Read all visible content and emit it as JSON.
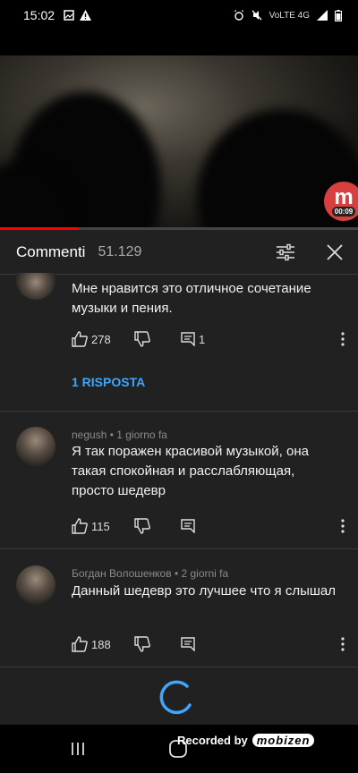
{
  "status_bar": {
    "time": "15:02",
    "icons": [
      "image-icon",
      "warning-icon"
    ],
    "right_icons": [
      "alarm-icon",
      "mute-icon",
      "4g-icon",
      "signal-icon",
      "battery-icon"
    ],
    "right_text": "VoLTE 4G"
  },
  "video": {
    "badge_letter": "m",
    "badge_time": "00:09",
    "progress": 0.22
  },
  "panel": {
    "title": "Commenti",
    "count": "51.129"
  },
  "comments": [
    {
      "author_meta": "",
      "text": "Мне нравится это отличное сочетание музыки и пения.",
      "likes": "278",
      "replies": "1",
      "reply_link": "1 RISPOSTA"
    },
    {
      "author_meta": "negush • 1 giorno fa",
      "text": "Я так поражен красивой музыкой, она такая спокойная и расслабляющая, просто шедевр",
      "likes": "115",
      "replies": ""
    },
    {
      "author_meta": "Богдан Волошенков • 2 giorni fa",
      "text": "Данный шедевр это лучшее что я слышал",
      "likes": "188",
      "replies": ""
    }
  ],
  "recorder": {
    "label": "Recorded by",
    "brand": "mobizen"
  },
  "colors": {
    "accent": "#3ea6ff",
    "badge": "#d8403f",
    "progress": "#ff0000",
    "panel": "#212121"
  }
}
